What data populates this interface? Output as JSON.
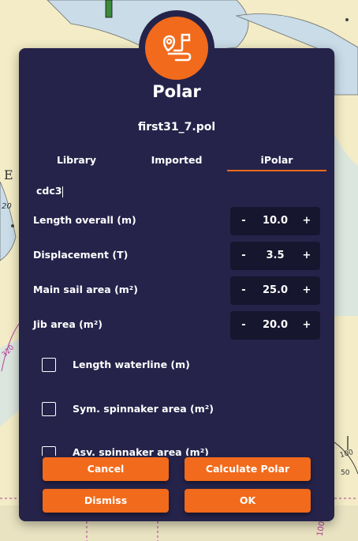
{
  "dialog": {
    "logo_icon": "route-pin-icon",
    "title": "Polar",
    "filename": "first31_7.pol"
  },
  "tabs": [
    {
      "label": "Library",
      "active": false
    },
    {
      "label": "Imported",
      "active": false
    },
    {
      "label": "iPolar",
      "active": true
    }
  ],
  "boat_name": "cdc3",
  "parameters": [
    {
      "label": "Length overall (m)",
      "value": "10.0",
      "minus": "-",
      "plus": "+"
    },
    {
      "label": "Displacement (T)",
      "value": "3.5",
      "minus": "-",
      "plus": "+"
    },
    {
      "label": "Main sail area (m²)",
      "value": "25.0",
      "minus": "-",
      "plus": "+"
    },
    {
      "label": "Jib area (m²)",
      "value": "20.0",
      "minus": "-",
      "plus": "+"
    }
  ],
  "optional_parameters": [
    {
      "label": "Length waterline (m)",
      "checked": false
    },
    {
      "label": "Sym. spinnaker area (m²)",
      "checked": false
    },
    {
      "label": "Asy. spinnaker area (m²)",
      "checked": false
    }
  ],
  "buttons": {
    "cancel": "Cancel",
    "calculate": "Calculate Polar",
    "dismiss": "Dismiss",
    "ok": "OK"
  },
  "map_labels": {
    "depth_20": "20",
    "bearing_320": "320",
    "scale_100_right": "100",
    "scale_50": "50",
    "scale_100_bottom": "100",
    "letter_e": "E"
  },
  "colors": {
    "accent": "#f26a1b",
    "dialog_bg": "#25234a",
    "stepper_bg": "#17162f",
    "map_land": "#f3ecc6",
    "map_water": "#c9dce8"
  }
}
